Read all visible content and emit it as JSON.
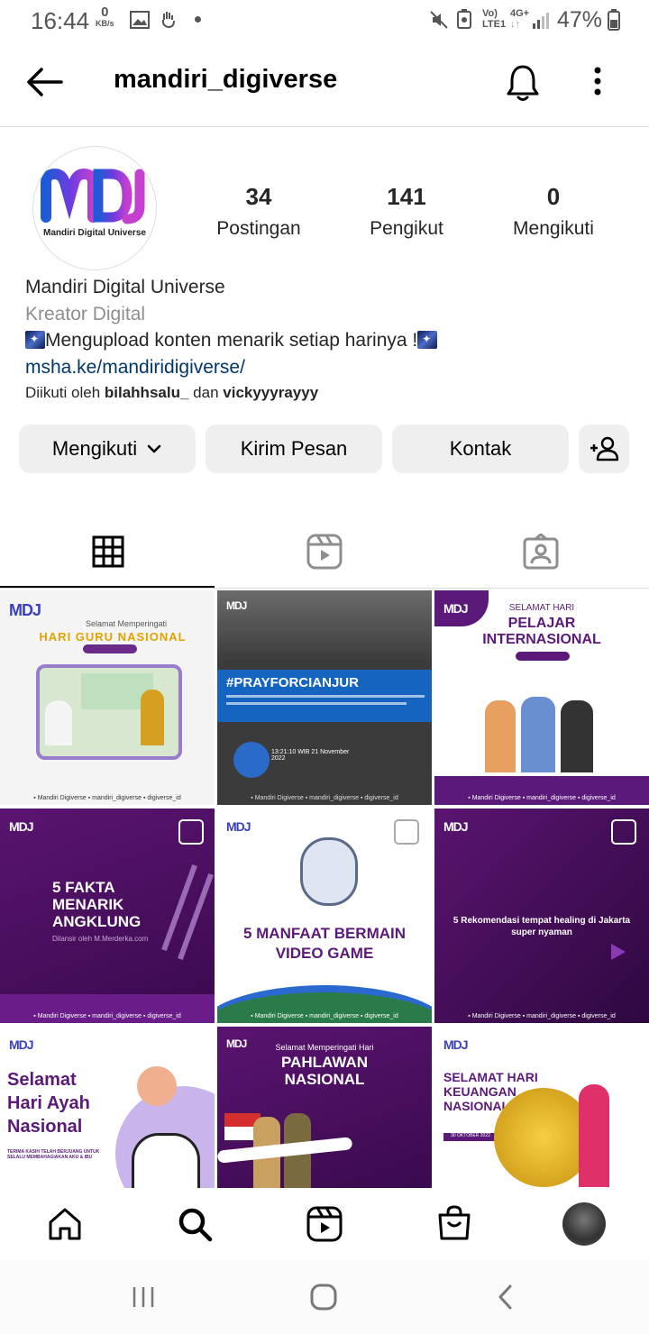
{
  "status_bar": {
    "time": "16:44",
    "kbs_value": "0",
    "kbs_unit": "KB/s",
    "network_top": "Vo)",
    "network_bottom": "LTE1",
    "network_gen": "4G+",
    "battery": "47%"
  },
  "header": {
    "username": "mandiri_digiverse"
  },
  "profile": {
    "avatar_text": "Mandiri Digital Universe",
    "stats": [
      {
        "value": "34",
        "label": "Postingan"
      },
      {
        "value": "141",
        "label": "Pengikut"
      },
      {
        "value": "0",
        "label": "Mengikuti"
      }
    ],
    "name": "Mandiri Digital Universe",
    "category": "Kreator Digital",
    "bio": "Mengupload konten menarik setiap harinya !",
    "link": "msha.ke/mandiridigiverse/",
    "followed_prefix": "Diikuti oleh",
    "followed_user1": "bilahhsalu_",
    "followed_and": "dan",
    "followed_user2": "vickyyyrayyy"
  },
  "actions": {
    "following": "Mengikuti",
    "message": "Kirim Pesan",
    "contact": "Kontak"
  },
  "tabs": [
    "grid-icon",
    "reels-icon",
    "tagged-icon"
  ],
  "posts": [
    {
      "caption": "HARI GURU NASIONAL",
      "sub": "Selamat Memperingati",
      "bg": "#f5f5f5"
    },
    {
      "caption": "#PRAYFORCIANJUR",
      "sub": "13:21:10 WIB 21 November 2022",
      "bg": "#2e2e2e"
    },
    {
      "caption": "PELAJAR INTERNASIONAL",
      "sub": "SELAMAT HARI",
      "bg": "#ffffff"
    },
    {
      "caption": "5 FAKTA MENARIK ANGKLUNG",
      "sub": "Dilansir oleh M.Merderka.com",
      "bg": "#4a1060"
    },
    {
      "caption": "5 MANFAAT BERMAIN VIDEO GAME",
      "sub": "",
      "bg": "#ffffff"
    },
    {
      "caption": "5 Rekomendasi tempat healing di Jakarta super nyaman",
      "sub": "",
      "bg": "#3e0a55"
    },
    {
      "caption": "Selamat Hari Ayah Nasional",
      "sub": "TERIMA KASIH TELAH BERJUANG UNTUK SELALU MEMBAHAGIAKAN AKU & IBU",
      "bg": "#ffffff"
    },
    {
      "caption": "PAHLAWAN NASIONAL",
      "sub": "Selamat Memperingati Hari",
      "bg": "#4a1060"
    },
    {
      "caption": "SELAMAT HARI KEUANGAN NASIONAL",
      "sub": "30 OKTOBER 2022",
      "bg": "#ffffff"
    }
  ],
  "post_logo": "MDJ",
  "colors": {
    "accent_purple": "#5b1a7a",
    "link_blue": "#00376b",
    "button_gray": "#efefef"
  }
}
